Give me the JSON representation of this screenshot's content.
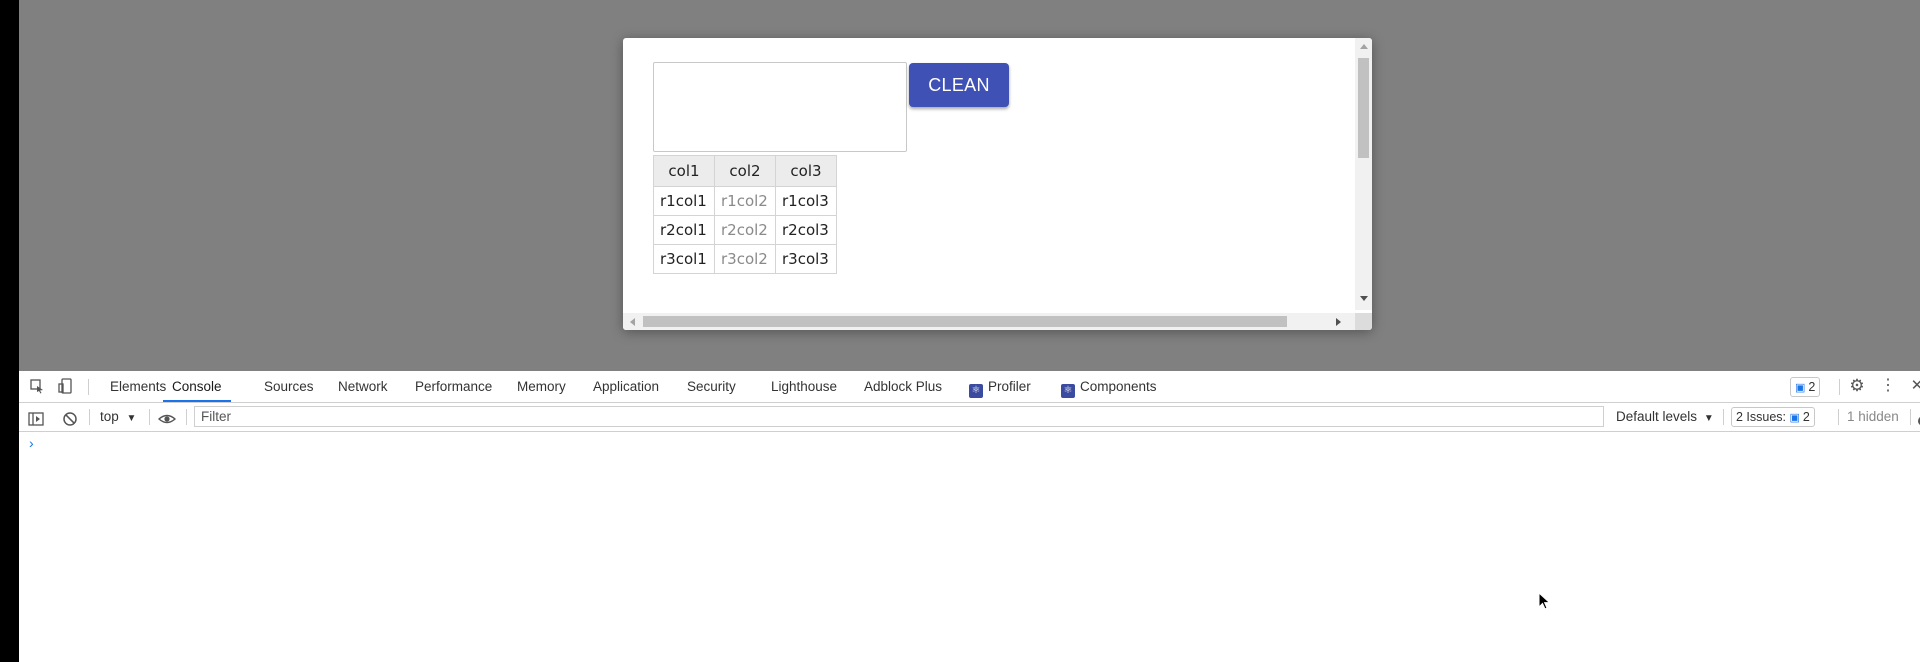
{
  "page": {
    "clean_button": "CLEAN",
    "table": {
      "headers": [
        "col1",
        "col2",
        "col3"
      ],
      "rows": [
        [
          "r1col1",
          "r1col2",
          "r1col3"
        ],
        [
          "r2col1",
          "r2col2",
          "r2col3"
        ],
        [
          "r3col1",
          "r3col2",
          "r3col3"
        ]
      ]
    }
  },
  "devtools": {
    "tabs": [
      "Elements",
      "Console",
      "Sources",
      "Network",
      "Performance",
      "Memory",
      "Application",
      "Security",
      "Lighthouse",
      "Adblock Plus",
      "Profiler",
      "Components"
    ],
    "active_tab": "Console",
    "messages_badge": "2",
    "context": "top",
    "filter_placeholder": "Filter",
    "levels": "Default levels",
    "issues_label": "2 Issues:",
    "issues_count": "2",
    "hidden": "1 hidden",
    "prompt": "›"
  },
  "colors": {
    "button": "#3f51b5",
    "active_tab_underline": "#1a73e8",
    "react_badge": "#3b4ba0"
  }
}
